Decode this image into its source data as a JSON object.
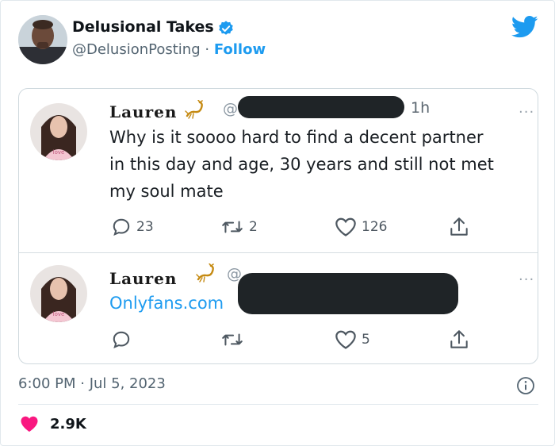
{
  "author": {
    "name": "Delusional Takes",
    "handle": "@DelusionPosting",
    "separator": " · ",
    "follow_label": "Follow"
  },
  "embedded_screenshot": {
    "tweet_1": {
      "name": "Lauren",
      "at": "@",
      "time": "1h",
      "more": "···",
      "lines": [
        "Why is it soooo hard to find a decent partner",
        "in this day and age, 30 years and still not met",
        "my soul mate"
      ],
      "replies": "23",
      "retweets": "2",
      "likes": "126"
    },
    "tweet_2": {
      "name": "Lauren",
      "at": "@",
      "more": "···",
      "link": "Onlyfans.com",
      "likes": "5"
    }
  },
  "footer": {
    "timestamp": "6:00 PM · Jul 5, 2023",
    "like_count": "2.9K"
  },
  "colors": {
    "twitter_blue": "#1d9bf0",
    "heart_red": "#f91880",
    "text_primary": "#0f1419",
    "text_secondary": "#536471"
  },
  "icons": [
    "twitter-bird-icon",
    "verified-badge-icon",
    "reply-icon",
    "retweet-icon",
    "like-icon",
    "share-icon",
    "info-icon",
    "heart-icon",
    "scorpion-icon"
  ]
}
